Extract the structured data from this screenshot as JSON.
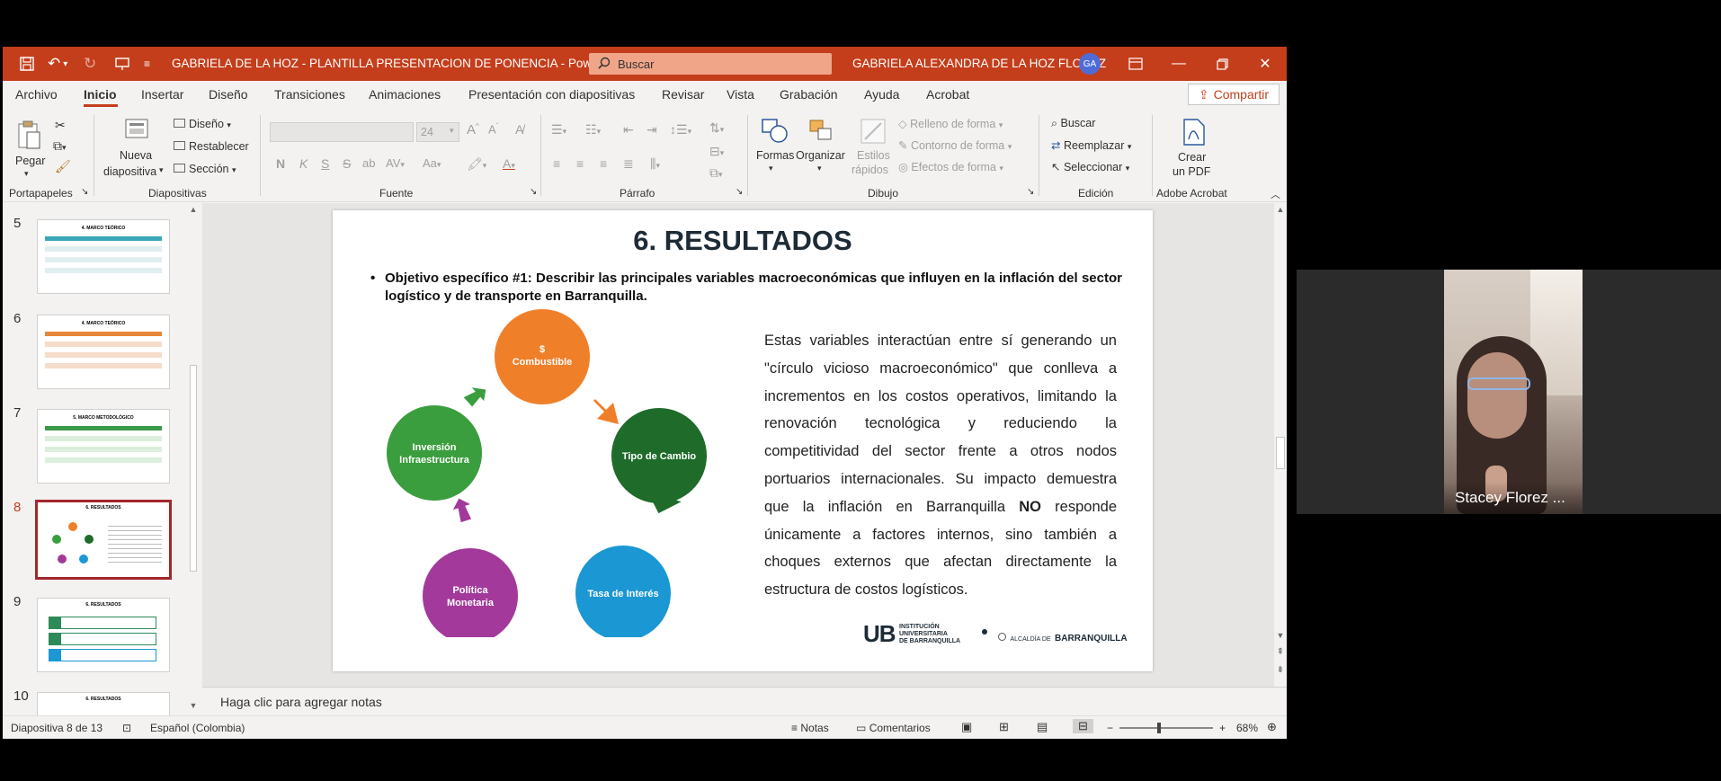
{
  "titlebar": {
    "document_title": "GABRIELA DE LA HOZ - PLANTILLA PRESENTACION DE PONENCIA  -  PowerPoint",
    "search_placeholder": "Buscar",
    "user_name": "GABRIELA ALEXANDRA DE LA HOZ FLOREZ",
    "user_initials": "GA"
  },
  "menu": {
    "tabs": [
      "Archivo",
      "Inicio",
      "Insertar",
      "Diseño",
      "Transiciones",
      "Animaciones",
      "Presentación con diapositivas",
      "Revisar",
      "Vista",
      "Grabación",
      "Ayuda",
      "Acrobat"
    ],
    "active_tab": "Inicio",
    "share_label": "Compartir"
  },
  "ribbon": {
    "portapapeles": {
      "label": "Portapapeles",
      "paste": "Pegar"
    },
    "diapositivas": {
      "label": "Diapositivas",
      "new_slide_1": "Nueva",
      "new_slide_2": "diapositiva",
      "layout": "Diseño",
      "reset": "Restablecer",
      "section": "Sección"
    },
    "fuente": {
      "label": "Fuente",
      "size": "24"
    },
    "parrafo": {
      "label": "Párrafo"
    },
    "dibujo": {
      "label": "Dibujo",
      "shapes": "Formas",
      "arrange": "Organizar",
      "quick_styles_1": "Estilos",
      "quick_styles_2": "rápidos",
      "fill": "Relleno de forma",
      "outline": "Contorno de forma",
      "effects": "Efectos de forma"
    },
    "edicion": {
      "label": "Edición",
      "find": "Buscar",
      "replace": "Reemplazar",
      "select": "Seleccionar"
    },
    "acrobat": {
      "label": "Adobe Acrobat",
      "create_1": "Crear",
      "create_2": "un PDF"
    }
  },
  "thumbnails": [
    {
      "num": "5",
      "title": "4. MARCO TEÓRICO",
      "accent": "#3aa8b8"
    },
    {
      "num": "6",
      "title": "4. MARCO TEÓRICO",
      "accent": "#e8873a"
    },
    {
      "num": "7",
      "title": "5. MARCO METODOLÓGICO",
      "accent": "#3a9a4a"
    },
    {
      "num": "8",
      "title": "6. RESULTADOS",
      "accent": "#a3262a"
    },
    {
      "num": "9",
      "title": "6. RESULTADOS",
      "accent": "#2f8a5a"
    },
    {
      "num": "10",
      "title": "6. RESULTADOS",
      "accent": "#888888"
    }
  ],
  "slide": {
    "title": "6. RESULTADOS",
    "bullet": "•",
    "objective": "Objetivo específico #1: Describir las principales variables macroeconómicas que influyen en la inflación del sector logístico y de transporte en Barranquilla.",
    "paragraph_before": "Estas variables interactúan entre sí generando un \"círculo vicioso macroeconómico\" que conlleva a incrementos en los costos operativos, limitando la renovación tecnológica y reduciendo la competitividad del sector frente a otros nodos portuarios internacionales. Su impacto demuestra que la inflación en Barranquilla ",
    "paragraph_bold": "NO",
    "paragraph_after": " responde únicamente a factores internos, sino también a choques externos que afectan directamente la estructura de costos logísticos.",
    "cycle": [
      {
        "line1": "$",
        "line2": "Combustible",
        "color": "#f07f2a"
      },
      {
        "line1": "Tipo de Cambio",
        "line2": "",
        "color": "#1f6b2a"
      },
      {
        "line1": "Tasa de Interés",
        "line2": "",
        "color": "#1b97d4"
      },
      {
        "line1": "Política",
        "line2": "Monetaria",
        "color": "#a3399a"
      },
      {
        "line1": "Inversión",
        "line2": "Infraestructura",
        "color": "#3a9e3e"
      }
    ],
    "logo_ub": "UB",
    "logo_inst_1": "INSTITUCIÓN",
    "logo_inst_2": "UNIVERSITARIA",
    "logo_inst_3": "DE BARRANQUILLA",
    "logo_alcaldia_small": "ALCALDÍA DE",
    "logo_alcaldia_big": "BARRANQUILLA"
  },
  "notes_placeholder": "Haga clic para agregar notas",
  "status": {
    "slide_counter": "Diapositiva 8 de 13",
    "language": "Español (Colombia)",
    "notes": "Notas",
    "comments": "Comentarios",
    "zoom": "68%"
  },
  "video": {
    "participant": "Stacey Florez ..."
  }
}
